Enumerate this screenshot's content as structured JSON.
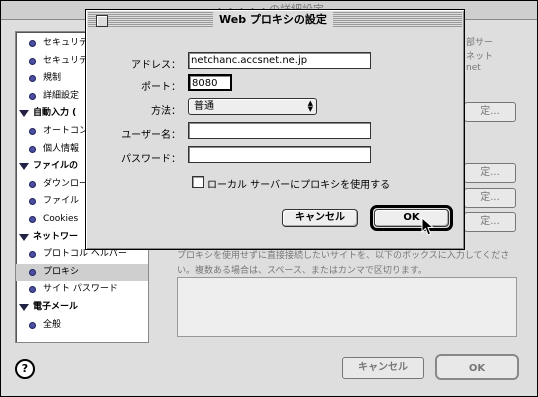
{
  "background_window": {
    "title": "・・・・・の詳細設定",
    "sidebar": [
      {
        "label": "セキュリテ",
        "type": "item"
      },
      {
        "label": "セキュリテ",
        "type": "item"
      },
      {
        "label": "規制",
        "type": "item"
      },
      {
        "label": "詳細設定",
        "type": "item"
      },
      {
        "label": "自動入力 (",
        "type": "header"
      },
      {
        "label": "オートコン",
        "type": "item"
      },
      {
        "label": "個人情報",
        "type": "item"
      },
      {
        "label": "ファイルの",
        "type": "header"
      },
      {
        "label": "ダウンロー",
        "type": "item"
      },
      {
        "label": "ファイル ・",
        "type": "item"
      },
      {
        "label": "Cookies",
        "type": "item"
      },
      {
        "label": "ネットワー",
        "type": "header"
      },
      {
        "label": "プロトコル ヘルパー",
        "type": "item"
      },
      {
        "label": "プロキシ",
        "type": "item",
        "selected": true
      },
      {
        "label": "サイト パスワード",
        "type": "item"
      },
      {
        "label": "電子メール",
        "type": "header"
      },
      {
        "label": "全般",
        "type": "item"
      }
    ],
    "right_fragments": [
      "部サー",
      "ネット",
      "net"
    ],
    "side_buttons": [
      "定...",
      "定...",
      "定...",
      "定..."
    ],
    "bypass_text": "プロキシを使用せずに直接接続したいサイトを、以下のボックスに入力してください。複数ある場合は、スペース、またはカンマで区切ります。",
    "cancel_label": "キャンセル",
    "ok_label": "OK",
    "help_label": "?"
  },
  "dialog": {
    "title": "Web プロキシの設定",
    "address_label": "アドレス：",
    "address_value": "netchanc.accsnet.ne.jp",
    "port_label": "ポート：",
    "port_value": "8080",
    "method_label": "方法：",
    "method_value": "普通",
    "username_label": "ユーザー名：",
    "username_value": "",
    "password_label": "パスワード：",
    "password_value": "",
    "local_checkbox_label": "ローカル サーバーにプロキシを使用する",
    "local_checkbox_checked": false,
    "cancel_label": "キャンセル",
    "ok_label": "OK"
  }
}
